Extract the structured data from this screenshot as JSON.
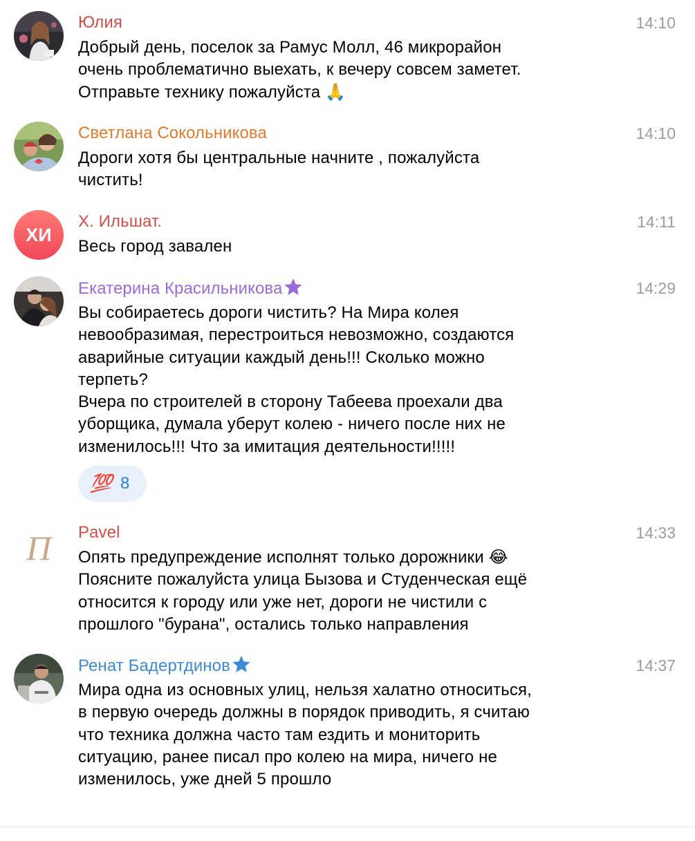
{
  "colors": {
    "yulia": "#cf4f49",
    "svetlana": "#e07b2c",
    "ilshat": "#cf4f49",
    "ekaterina": "#9a6bd6",
    "pavel": "#cf4f49",
    "renat": "#3d8ad6",
    "time": "#9c9ca1",
    "reaction_bg": "#e8f1fb",
    "reaction_count": "#2f7fd3"
  },
  "messages": [
    {
      "author": "Юлия",
      "time": "14:10",
      "lines": [
        "Добрый день, поселок за Рамус Молл, 46 микрорайон",
        "очень проблематично выехать, к вечеру совсем заметет.",
        "Отправьте технику пожалуйста 🙏"
      ]
    },
    {
      "author": "Светлана Сокольникова",
      "time": "14:10",
      "lines": [
        "Дороги хотя бы центральные начните , пожалуйста",
        "чистить!"
      ]
    },
    {
      "author": "Х. Ильшат.",
      "avatar_initials": "ХИ",
      "time": "14:11",
      "lines": [
        "Весь город завален"
      ]
    },
    {
      "author": "Екатерина Красильникова",
      "time": "14:29",
      "lines": [
        "Вы собираетесь дороги чистить? На Мира колея",
        "невообразимая, перестроиться невозможно, создаются",
        "аварийные ситуации каждый день!!! Сколько можно",
        "терпеть?",
        "Вчера по строителей в сторону Табеева проехали два",
        "уборщика, думала уберут колею - ничего после них не",
        "изменилось!!! Что за имитация деятельности!!!!!"
      ],
      "reaction": {
        "emoji": "💯",
        "emoji_icon": "hundred-points-icon",
        "count": "8"
      }
    },
    {
      "author": "Pavel",
      "avatar_monogram": "П",
      "time": "14:33",
      "lines": [
        "Опять предупреждение исполнят только дорожники 😂",
        "Поясните пожалуйста улица Бызова и Студенческая ещё",
        "относится к городу или уже нет, дороги не чистили с",
        "прошлого \"бурана\", остались только направления"
      ]
    },
    {
      "author": "Ренат Бадертдинов",
      "time": "14:37",
      "lines": [
        "Мира одна из основных улиц, нельзя халатно относиться,",
        "в первую очередь должны в порядок приводить, я считаю",
        "что техника должна часто там ездить и мониторить",
        "ситуацию, ранее писал про колею на мира, ничего не",
        "изменилось, уже дней 5 прошло"
      ]
    }
  ]
}
